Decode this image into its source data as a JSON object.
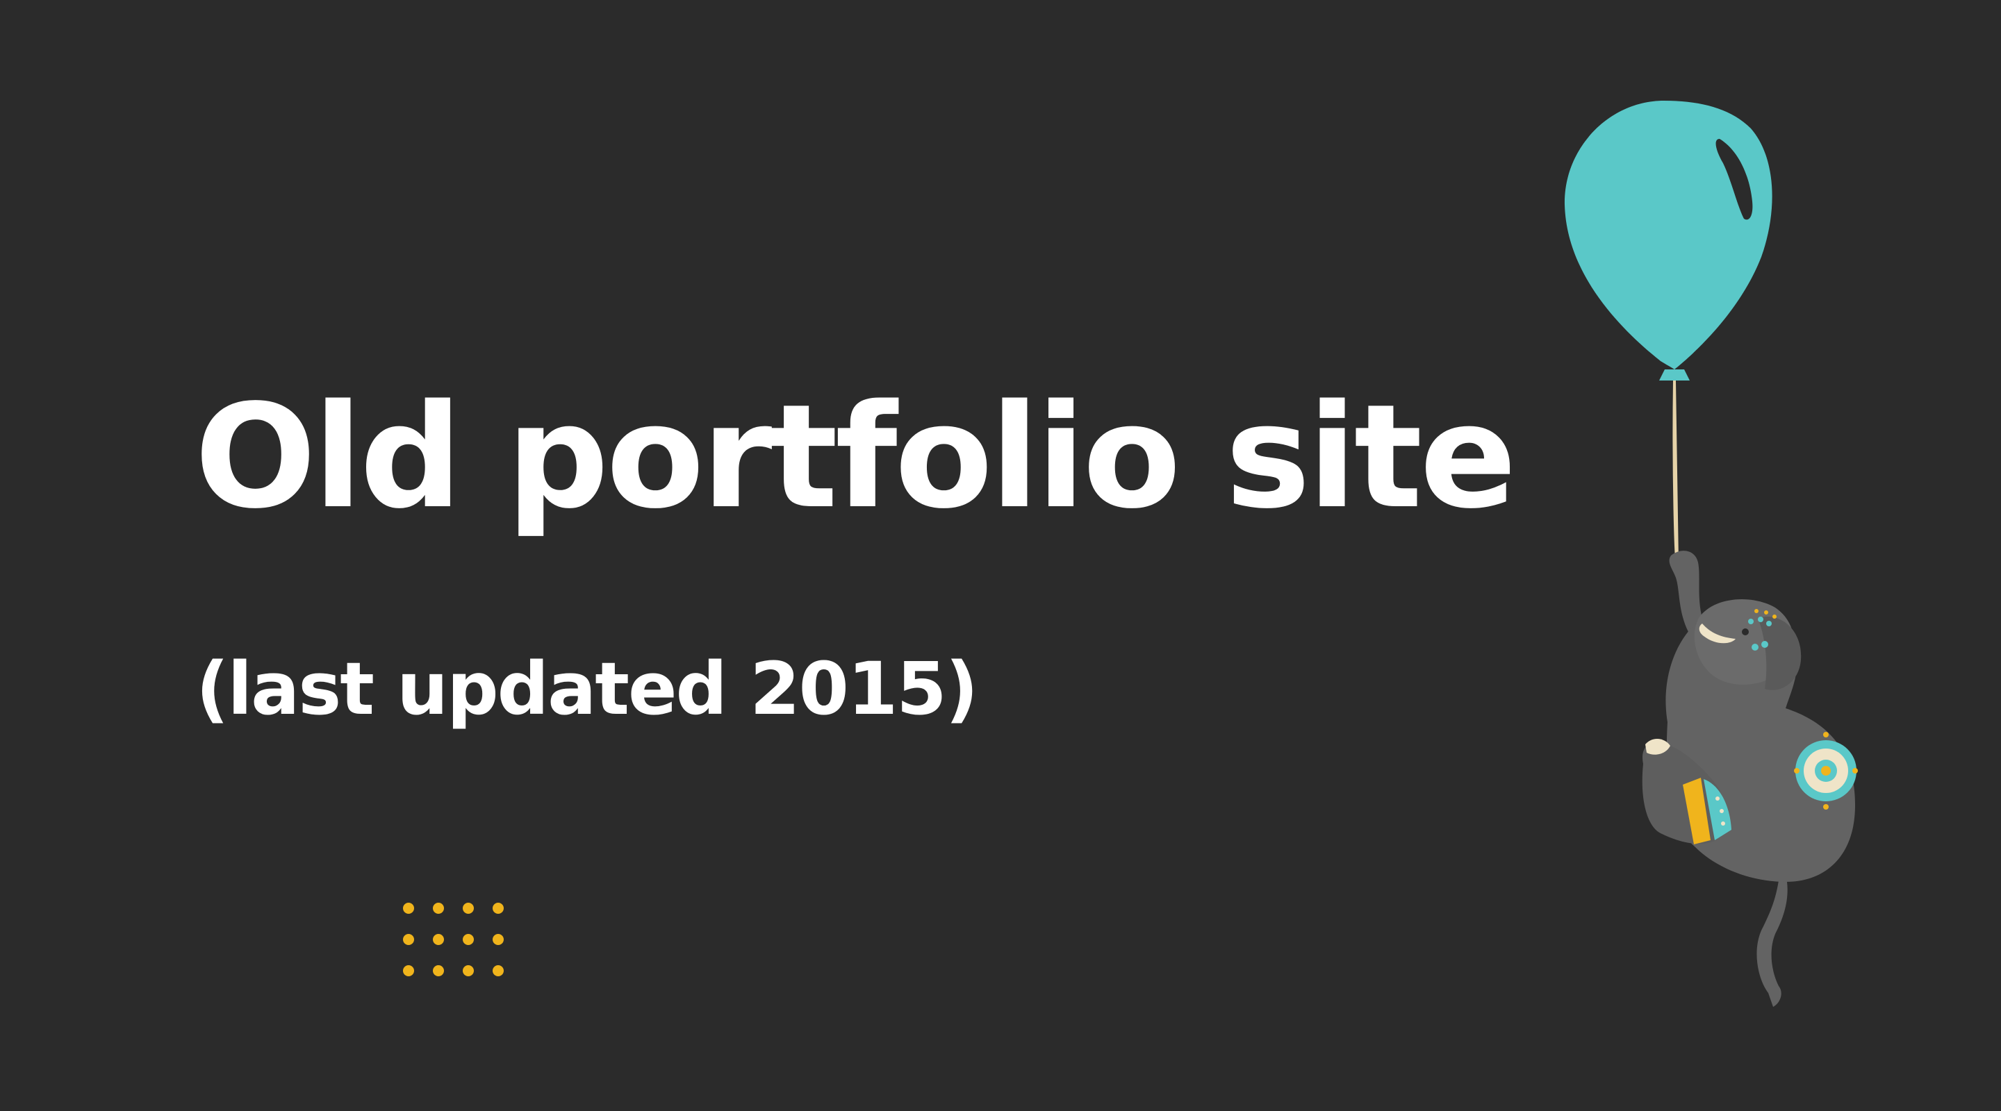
{
  "page": {
    "title": "Old portfolio site",
    "subtitle": "(last updated 2015)"
  },
  "colors": {
    "background": "#2b2b2b",
    "text": "#ffffff",
    "accent_dots": "#f0b41c",
    "balloon": "#5ac8c8",
    "elephant": "#666666"
  },
  "icons": {
    "dot_grid": "dot-grid-decoration",
    "illustration": "elephant-with-balloon-illustration"
  }
}
